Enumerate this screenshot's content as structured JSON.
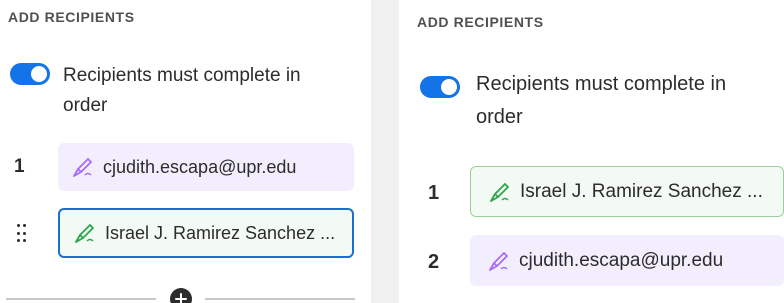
{
  "left_panel": {
    "section_title": "ADD RECIPIENTS",
    "toggle": {
      "state": "on",
      "label": "Recipients must complete in order"
    },
    "recipients": [
      {
        "order": "1",
        "email": "cjudith.escapa@upr.edu",
        "icon": "pen-icon",
        "color": "#a56bff"
      },
      {
        "order": "",
        "email": "Israel J. Ramirez Sanchez ...",
        "icon": "pen-icon",
        "color": "#2da44e",
        "state": "dragging"
      }
    ]
  },
  "right_panel": {
    "section_title": "ADD RECIPIENTS",
    "toggle": {
      "state": "on",
      "label": "Recipients must complete in order"
    },
    "recipients": [
      {
        "order": "1",
        "email": "Israel J. Ramirez Sanchez ...",
        "icon": "pen-icon",
        "color": "#2da44e"
      },
      {
        "order": "2",
        "email": "cjudith.escapa@upr.edu",
        "icon": "pen-icon",
        "color": "#a56bff"
      }
    ]
  },
  "colors": {
    "accent": "#1473e6",
    "purple": "#a56bff",
    "green": "#2da44e"
  }
}
